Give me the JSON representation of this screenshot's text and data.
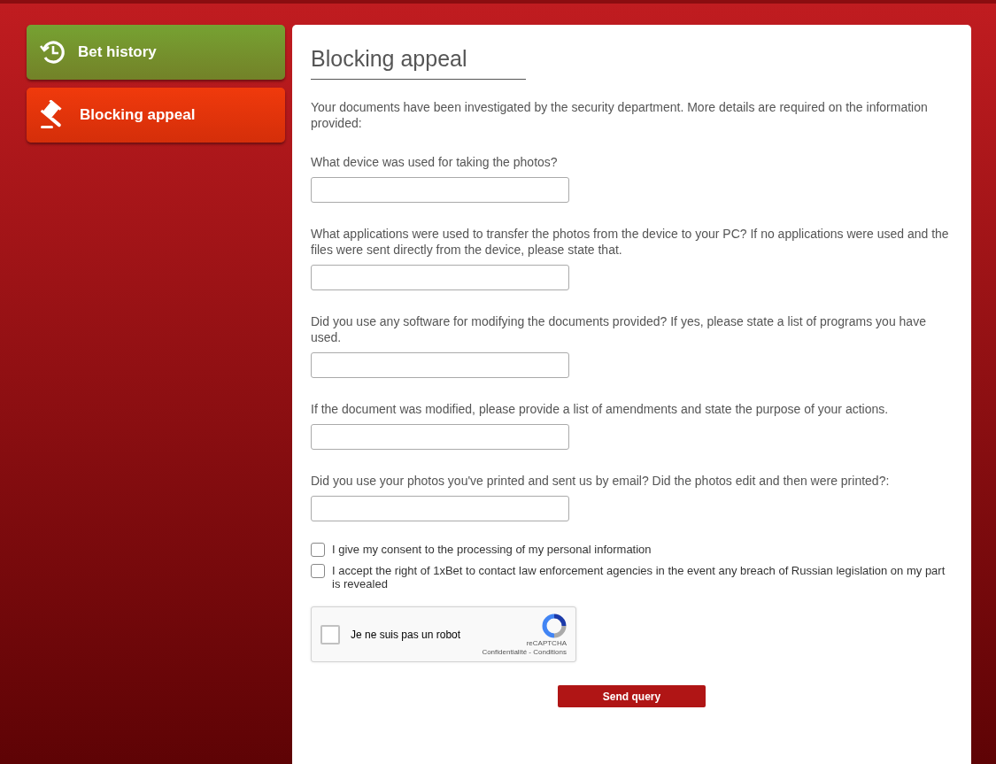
{
  "sidebar": {
    "items": [
      {
        "label": "Bet history",
        "kind": "history",
        "color": "#76a232"
      },
      {
        "label": "Blocking appeal",
        "kind": "gavel",
        "color": "#f03a0c"
      }
    ]
  },
  "form": {
    "title": "Blocking appeal",
    "intro": "Your documents have been investigated by the security department. More details are required on the information provided:",
    "questions": [
      {
        "label": "What device was used for taking the photos?"
      },
      {
        "label": "What applications were used to transfer the photos from the device to your PC? If no applications were used and the files were sent directly from the device, please state that."
      },
      {
        "label": "Did you use any software for modifying the documents provided? If yes, please state a list of programs you have used."
      },
      {
        "label": "If the document was modified, please provide a list of amendments and state the purpose of your actions."
      },
      {
        "label": "Did you use your photos you've printed and sent us by email? Did the photos edit and then were printed?:"
      }
    ],
    "consents": [
      {
        "label": "I give my consent to the processing of my personal information",
        "checked": false
      },
      {
        "label": "I accept the right of 1xBet to contact law enforcement agencies in the event any breach of Russian legislation on my part is revealed",
        "checked": false
      }
    ],
    "captcha": {
      "label": "Je ne suis pas un robot",
      "checked": false,
      "brand": "reCAPTCHA",
      "links": "Confidentialité - Conditions"
    },
    "submit": "Send query"
  }
}
